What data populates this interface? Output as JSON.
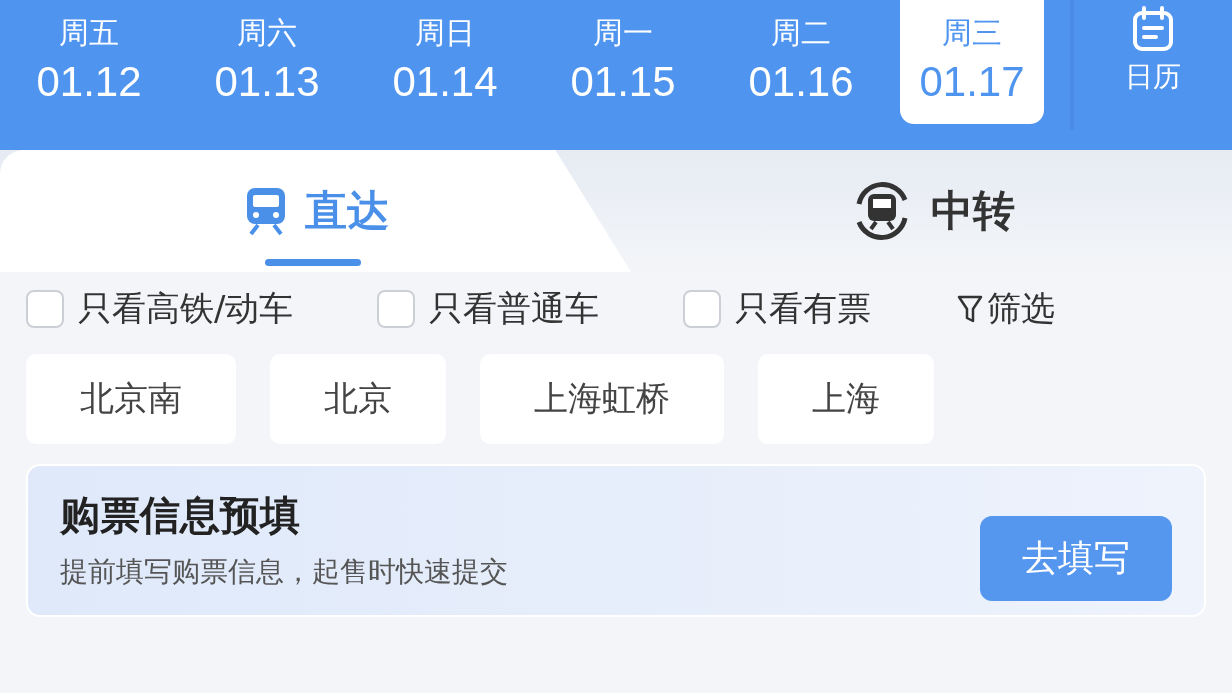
{
  "dates": [
    {
      "weekday": "周五",
      "date": "01.12",
      "selected": false
    },
    {
      "weekday": "周六",
      "date": "01.13",
      "selected": false
    },
    {
      "weekday": "周日",
      "date": "01.14",
      "selected": false
    },
    {
      "weekday": "周一",
      "date": "01.15",
      "selected": false
    },
    {
      "weekday": "周二",
      "date": "01.16",
      "selected": false
    },
    {
      "weekday": "周三",
      "date": "01.17",
      "selected": true
    }
  ],
  "calendar": {
    "label": "日历"
  },
  "tabs": [
    {
      "label": "直达",
      "selected": true
    },
    {
      "label": "中转",
      "selected": false
    }
  ],
  "filters": [
    {
      "label": "只看高铁/动车",
      "checked": false
    },
    {
      "label": "只看普通车",
      "checked": false
    },
    {
      "label": "只看有票",
      "checked": false
    }
  ],
  "filter_button": {
    "label": "筛选"
  },
  "stations": [
    "北京南",
    "北京",
    "上海虹桥",
    "上海"
  ],
  "prefill_card": {
    "title": "购票信息预填",
    "subtitle": "提前填写购票信息，起售时快速提交",
    "button": "去填写"
  }
}
